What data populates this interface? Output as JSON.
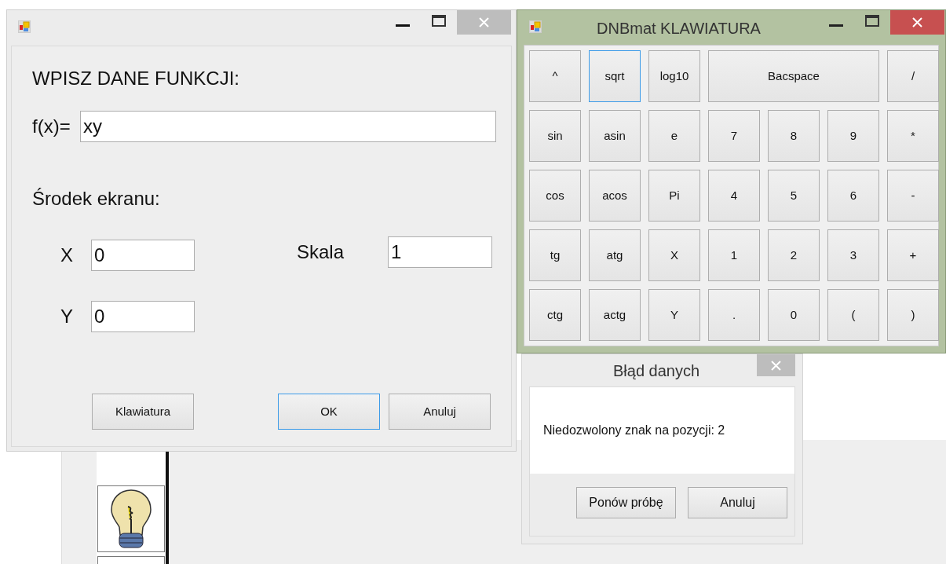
{
  "main_dialog": {
    "active": false,
    "heading": "WPISZ DANE FUNKCJI:",
    "function_label": "f(x)=",
    "function_value": "xy",
    "center_label": "Środek ekranu:",
    "fields": [
      {
        "label": "X",
        "value": "0"
      },
      {
        "label": "Skala",
        "value": "1"
      },
      {
        "label": "Y",
        "value": "0"
      }
    ],
    "buttons": [
      {
        "label": "Klawiatura",
        "focused": false
      },
      {
        "label": "OK",
        "focused": true
      },
      {
        "label": "Anuluj",
        "focused": false
      }
    ]
  },
  "keyboard_window": {
    "active": true,
    "title": "DNBmat KLAWIATURA",
    "keys": [
      [
        {
          "label": "^",
          "focused": false
        },
        {
          "label": "sqrt",
          "focused": true
        },
        {
          "label": "log10",
          "focused": false
        },
        {
          "label": "Bacspace",
          "focused": false
        },
        {
          "label": "/",
          "focused": false
        }
      ],
      [
        {
          "label": "sin",
          "focused": false
        },
        {
          "label": "asin",
          "focused": false
        },
        {
          "label": "e",
          "focused": false
        },
        {
          "label": "7",
          "focused": false
        },
        {
          "label": "8",
          "focused": false
        },
        {
          "label": "9",
          "focused": false
        },
        {
          "label": "*",
          "focused": false
        }
      ],
      [
        {
          "label": "cos",
          "focused": false
        },
        {
          "label": "acos",
          "focused": false
        },
        {
          "label": "Pi",
          "focused": false
        },
        {
          "label": "4",
          "focused": false
        },
        {
          "label": "5",
          "focused": false
        },
        {
          "label": "6",
          "focused": false
        },
        {
          "label": "-",
          "focused": false
        }
      ],
      [
        {
          "label": "tg",
          "focused": false
        },
        {
          "label": "atg",
          "focused": false
        },
        {
          "label": "X",
          "focused": false
        },
        {
          "label": "1",
          "focused": false
        },
        {
          "label": "2",
          "focused": false
        },
        {
          "label": "3",
          "focused": false
        },
        {
          "label": "+",
          "focused": false
        }
      ],
      [
        {
          "label": "ctg",
          "focused": false
        },
        {
          "label": "actg",
          "focused": false
        },
        {
          "label": "Y",
          "focused": false
        },
        {
          "label": ".",
          "focused": false
        },
        {
          "label": "0",
          "focused": false
        },
        {
          "label": "(",
          "focused": false
        },
        {
          "label": ")",
          "focused": false
        }
      ]
    ]
  },
  "error_dialog": {
    "active": false,
    "title": "Błąd danych",
    "message": "Niedozwolony znak na pozycji: 2",
    "buttons": [
      {
        "label": "Ponów próbę",
        "focused": false
      },
      {
        "label": "Anuluj",
        "focused": false
      }
    ]
  }
}
